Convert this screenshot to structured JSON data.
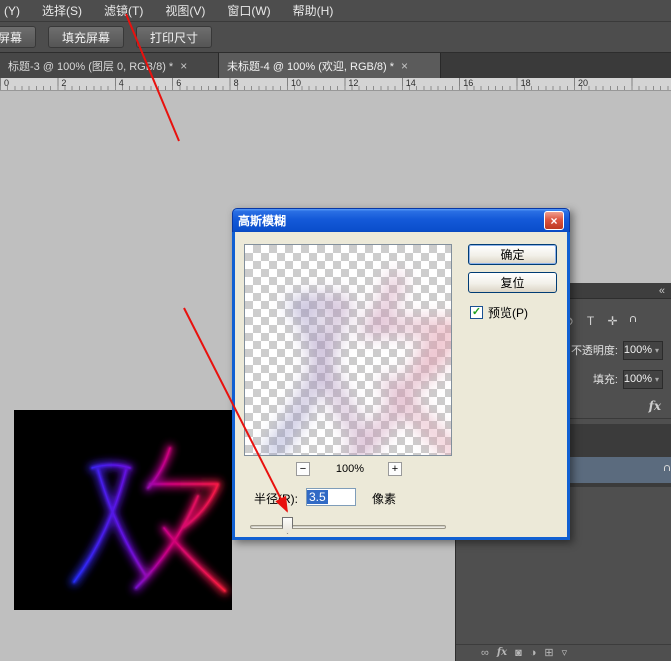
{
  "menubar": {
    "items": [
      {
        "name": "menu-item-clipped",
        "label": "(Y)"
      },
      {
        "name": "menu-item-select",
        "label": "选择(S)"
      },
      {
        "name": "menu-item-filter",
        "label": "滤镜(T)"
      },
      {
        "name": "menu-item-view",
        "label": "视图(V)"
      },
      {
        "name": "menu-item-window",
        "label": "窗口(W)"
      },
      {
        "name": "menu-item-help",
        "label": "帮助(H)"
      }
    ]
  },
  "options_bar": {
    "buttons": [
      {
        "name": "fit-screen-button",
        "label": "屏幕"
      },
      {
        "name": "fill-screen-button",
        "label": "填充屏幕"
      },
      {
        "name": "print-size-button",
        "label": "打印尺寸"
      }
    ]
  },
  "tabs": [
    {
      "label": "标题-3 @ 100% (图层 0, RGB/8) *",
      "close": "×"
    },
    {
      "label": "未标题-4 @ 100% (欢迎, RGB/8) *",
      "close": "×"
    }
  ],
  "ruler": {
    "numbers": [
      "0",
      "2",
      "4",
      "6",
      "8",
      "10",
      "12",
      "14",
      "16",
      "18",
      "20"
    ]
  },
  "document": {
    "artwork_character": "欢",
    "image_background": "#000000"
  },
  "dialog": {
    "title": "高斯模糊",
    "close": "×",
    "ok_label": "确定",
    "reset_label": "复位",
    "preview_label": "预览(P)",
    "preview_checked": true,
    "check_glyph": "✓",
    "zoom_out": "−",
    "zoom_level": "100%",
    "zoom_in": "+",
    "radius_label": "半径(R):",
    "radius_value": "3.5",
    "radius_unit": "像素"
  },
  "layers_panel": {
    "collapse_chevron": "«",
    "lock_icons": [
      {
        "name": "lock-transparency-icon",
        "glyph": "⊘"
      },
      {
        "name": "lock-pixels-icon",
        "glyph": "T"
      },
      {
        "name": "lock-position-icon",
        "glyph": "✛"
      }
    ],
    "opacity_label": "不透明度:",
    "opacity_value": "100%",
    "fill_label": "填充:",
    "fill_value": "100%",
    "dropdown_arrow": "▾",
    "fx_badge": "fx",
    "bottom_icons": [
      {
        "name": "link-layers-icon",
        "glyph": "∞"
      },
      {
        "name": "layer-style-icon",
        "glyph": "fx"
      },
      {
        "name": "layer-mask-icon",
        "glyph": "◙"
      },
      {
        "name": "adjustment-layer-icon",
        "glyph": "◑"
      },
      {
        "name": "new-layer-icon",
        "glyph": "⊞"
      },
      {
        "name": "delete-layer-icon",
        "glyph": "▿"
      }
    ]
  },
  "colors": {
    "annotation_red": "#e8110e",
    "selection_blue": "#316ac5",
    "neon_start": "#2030ff",
    "neon_end": "#ff2038",
    "xp_title_blue": "#1459d8"
  }
}
